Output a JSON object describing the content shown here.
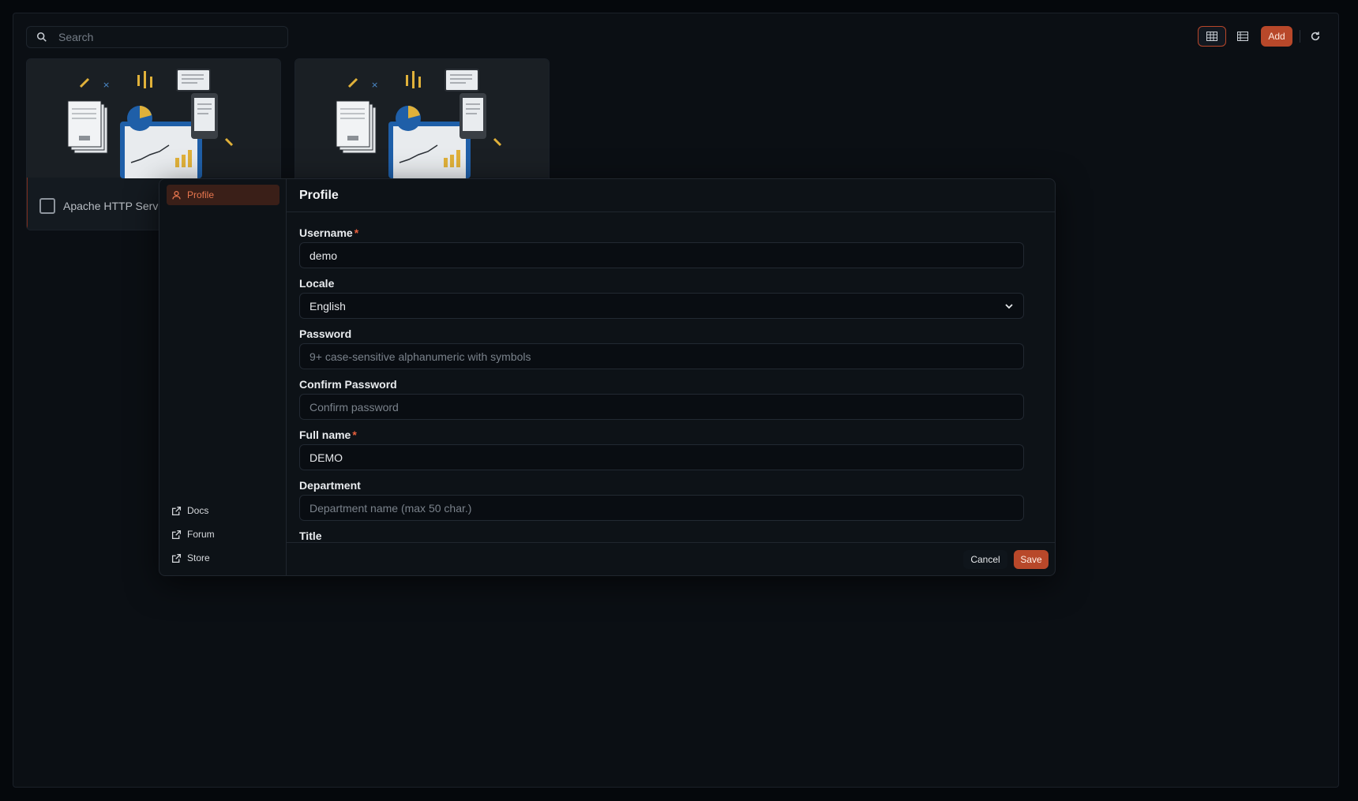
{
  "toolbar": {
    "search_placeholder": "Search",
    "add_label": "Add",
    "icons": [
      "search-icon",
      "grid-view-icon",
      "list-view-icon",
      "refresh-icon"
    ],
    "accent": "#b8482a"
  },
  "cards": [
    {
      "title": "Apache HTTP Server",
      "checked": false
    },
    {
      "title": "",
      "checked": false
    }
  ],
  "modal": {
    "sidebar": {
      "active_item": {
        "label": "Profile",
        "icon": "user-icon"
      },
      "links": [
        {
          "label": "Docs",
          "icon": "external-link-icon"
        },
        {
          "label": "Forum",
          "icon": "external-link-icon"
        },
        {
          "label": "Store",
          "icon": "external-link-icon"
        }
      ]
    },
    "title": "Profile",
    "fields": {
      "username": {
        "label": "Username",
        "required": "*",
        "value": "demo"
      },
      "locale": {
        "label": "Locale",
        "value": "English"
      },
      "password": {
        "label": "Password",
        "placeholder": "9+ case-sensitive alphanumeric with symbols"
      },
      "confirm_password": {
        "label": "Confirm Password",
        "placeholder": "Confirm password"
      },
      "full_name": {
        "label": "Full name",
        "required": "*",
        "value": "DEMO"
      },
      "department": {
        "label": "Department",
        "placeholder": "Department name (max 50 char.)"
      },
      "title": {
        "label": "Title"
      }
    },
    "buttons": {
      "cancel": "Cancel",
      "save": "Save"
    }
  }
}
